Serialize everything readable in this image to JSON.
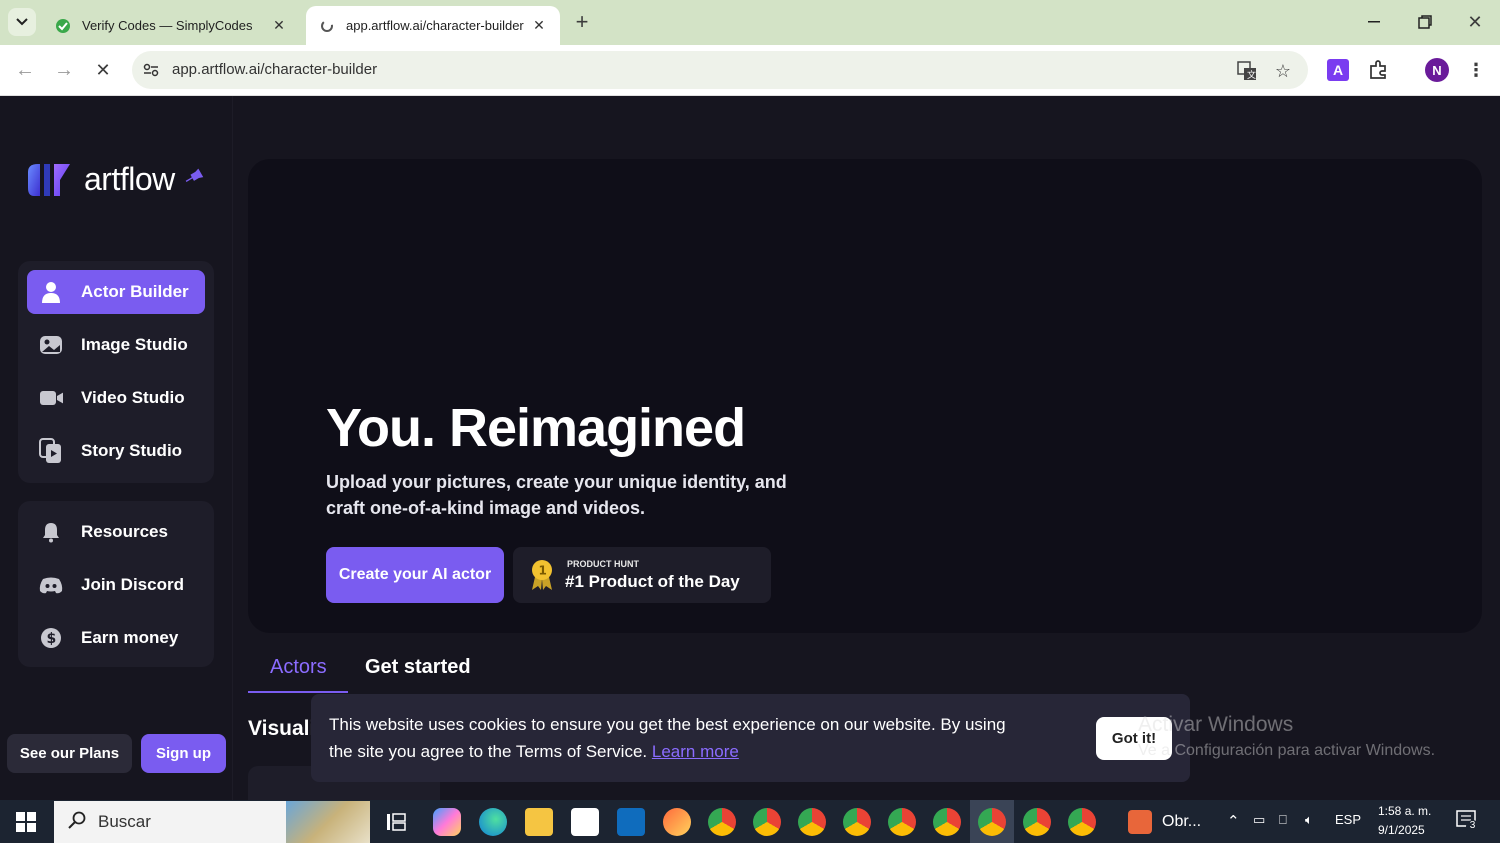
{
  "browser": {
    "tabs": [
      {
        "title": "Verify Codes — SimplyCodes",
        "active": false
      },
      {
        "title": "app.artflow.ai/character-builder",
        "active": true
      }
    ],
    "url": "app.artflow.ai/character-builder",
    "profile_initial": "N",
    "ext_initial": "A"
  },
  "sidebar": {
    "logo_text": "artflow",
    "primary_items": [
      {
        "label": "Actor Builder",
        "icon": "user-icon",
        "active": true
      },
      {
        "label": "Image Studio",
        "icon": "image-icon",
        "active": false
      },
      {
        "label": "Video Studio",
        "icon": "video-icon",
        "active": false
      },
      {
        "label": "Story Studio",
        "icon": "story-icon",
        "active": false
      }
    ],
    "secondary_items": [
      {
        "label": "Resources",
        "icon": "bell-icon"
      },
      {
        "label": "Join Discord",
        "icon": "discord-icon"
      },
      {
        "label": "Earn money",
        "icon": "dollar-icon"
      }
    ],
    "plans_label": "See our Plans",
    "signup_label": "Sign up"
  },
  "hero": {
    "title": "You. Reimagined",
    "subtitle": "Upload your pictures, create your unique identity, and craft one-of-a-kind image and videos.",
    "cta_label": "Create your AI actor",
    "badge_small": "PRODUCT HUNT",
    "badge_big": "#1 Product of the Day",
    "badge_number": "1"
  },
  "tabs": [
    {
      "label": "Actors",
      "active": true
    },
    {
      "label": "Get started",
      "active": false
    }
  ],
  "section_partial": "Visuali",
  "cookie": {
    "text": "This website uses cookies to ensure you get the best experience on our website. By using the site you agree to the Terms of Service.",
    "link": "Learn more",
    "button": "Got it!"
  },
  "watermark": {
    "line1": "Activar Windows",
    "line2": "Ve a Configuración para activar Windows."
  },
  "taskbar": {
    "search_placeholder": "Buscar",
    "weather_label": "Obr...",
    "lang": "ESP",
    "time": "1:58 a. m.",
    "date": "9/1/2025",
    "notifications": "3"
  },
  "colors": {
    "accent": "#7a5cf0",
    "background": "#16151f",
    "hero_bg": "#0f0e18",
    "tabbar": "#d3e3c6"
  }
}
